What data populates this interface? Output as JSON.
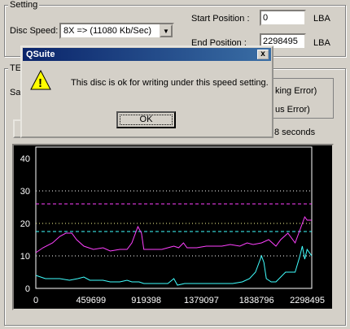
{
  "setting": {
    "title": "Setting",
    "disc_speed_label": "Disc Speed:",
    "disc_speed_value": "8X => (11080 Kb/Sec)",
    "start_label": "Start Position :",
    "start_value": "0",
    "end_label": "End Position :",
    "end_value": "2298495",
    "lba1": "LBA",
    "lba2": "LBA"
  },
  "test": {
    "title_fragment": "TE",
    "sa_fragment": "Sa",
    "error_frag1": "king Error)",
    "error_frag2": "us Error)",
    "seconds_text": "8 seconds"
  },
  "dialog": {
    "title": "QSuite",
    "message": "This disc is ok for writing under this speed setting.",
    "ok_label": "OK",
    "close_glyph": "x",
    "warning_glyph": "!"
  },
  "colors": {
    "magenta": "#ff40ff",
    "cyan": "#40ffff",
    "yellow_dotted": "#ffff99"
  },
  "chart_data": {
    "type": "line",
    "ylim": [
      0,
      42
    ],
    "yticks": [
      0,
      10,
      20,
      30,
      40
    ],
    "ytick_labels": [
      "0",
      "10",
      "20",
      "30",
      "40"
    ],
    "xlim": [
      0,
      2298495
    ],
    "xticks": [
      0,
      459699,
      919398,
      1379097,
      1838796,
      2298495
    ],
    "xtick_labels": [
      "0",
      "459699",
      "919398",
      "1379097",
      "1838796",
      "2298495"
    ],
    "reference_lines": [
      {
        "y": 30,
        "color": "#ffffff",
        "style": "dotted"
      },
      {
        "y": 26,
        "color": "#ff40ff",
        "style": "dashed"
      },
      {
        "y": 20,
        "color": "#ffff99",
        "style": "dotted"
      },
      {
        "y": 17.5,
        "color": "#40ffff",
        "style": "dashed"
      },
      {
        "y": 10,
        "color": "#ffffff",
        "style": "dotted"
      }
    ],
    "series": [
      {
        "color": "#ff40ff",
        "points": [
          [
            0,
            11
          ],
          [
            60000,
            12.5
          ],
          [
            140000,
            14
          ],
          [
            200000,
            16
          ],
          [
            250000,
            17
          ],
          [
            300000,
            17
          ],
          [
            340000,
            15
          ],
          [
            400000,
            13
          ],
          [
            480000,
            12
          ],
          [
            560000,
            12.5
          ],
          [
            620000,
            11.5
          ],
          [
            700000,
            12
          ],
          [
            760000,
            12
          ],
          [
            800000,
            14
          ],
          [
            850000,
            19
          ],
          [
            880000,
            17
          ],
          [
            900000,
            12
          ],
          [
            980000,
            12
          ],
          [
            1050000,
            12
          ],
          [
            1100000,
            12.5
          ],
          [
            1150000,
            13
          ],
          [
            1190000,
            12.5
          ],
          [
            1230000,
            14
          ],
          [
            1260000,
            12.5
          ],
          [
            1340000,
            12.5
          ],
          [
            1420000,
            13
          ],
          [
            1480000,
            13
          ],
          [
            1550000,
            13
          ],
          [
            1620000,
            13.5
          ],
          [
            1700000,
            13
          ],
          [
            1760000,
            14
          ],
          [
            1810000,
            13.5
          ],
          [
            1880000,
            14
          ],
          [
            1940000,
            15
          ],
          [
            2000000,
            13
          ],
          [
            2040000,
            15
          ],
          [
            2100000,
            17
          ],
          [
            2160000,
            14
          ],
          [
            2200000,
            18
          ],
          [
            2240000,
            22
          ],
          [
            2260000,
            21
          ],
          [
            2298495,
            21
          ]
        ]
      },
      {
        "color": "#40ffff",
        "points": [
          [
            0,
            4
          ],
          [
            80000,
            3
          ],
          [
            200000,
            3
          ],
          [
            280000,
            2.5
          ],
          [
            350000,
            3
          ],
          [
            400000,
            3.5
          ],
          [
            450000,
            2.5
          ],
          [
            560000,
            2.5
          ],
          [
            620000,
            2
          ],
          [
            700000,
            2
          ],
          [
            760000,
            2.5
          ],
          [
            800000,
            2
          ],
          [
            860000,
            2
          ],
          [
            900000,
            1.5
          ],
          [
            950000,
            1.5
          ],
          [
            1000000,
            1.5
          ],
          [
            1100000,
            1.5
          ],
          [
            1150000,
            3
          ],
          [
            1180000,
            1
          ],
          [
            1240000,
            1.5
          ],
          [
            1300000,
            1.5
          ],
          [
            1400000,
            1.5
          ],
          [
            1480000,
            1.5
          ],
          [
            1560000,
            1.5
          ],
          [
            1640000,
            1.5
          ],
          [
            1720000,
            2
          ],
          [
            1780000,
            3
          ],
          [
            1830000,
            5
          ],
          [
            1880000,
            10
          ],
          [
            1900000,
            8
          ],
          [
            1920000,
            3
          ],
          [
            1960000,
            2
          ],
          [
            2000000,
            2
          ],
          [
            2080000,
            5
          ],
          [
            2160000,
            5
          ],
          [
            2200000,
            10
          ],
          [
            2220000,
            13
          ],
          [
            2240000,
            9
          ],
          [
            2260000,
            12
          ],
          [
            2298495,
            10
          ]
        ]
      }
    ]
  }
}
